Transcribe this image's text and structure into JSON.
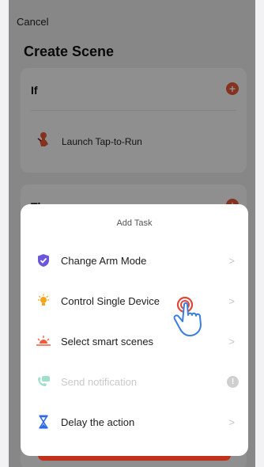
{
  "header": {
    "cancel_label": "Cancel",
    "title": "Create Scene"
  },
  "if_section": {
    "label": "If",
    "trigger_label": "Launch Tap-to-Run",
    "trigger_icon": "tap-hand-icon"
  },
  "then_section": {
    "label": "Then"
  },
  "sheet": {
    "title": "Add Task",
    "items": [
      {
        "label": "Change Arm Mode",
        "icon": "shield-check-icon",
        "disabled": false
      },
      {
        "label": "Control Single Device",
        "icon": "bulb-icon",
        "disabled": false
      },
      {
        "label": "Select smart scenes",
        "icon": "sunrise-icon",
        "disabled": false
      },
      {
        "label": "Send notification",
        "icon": "notification-phone-icon",
        "disabled": true
      },
      {
        "label": "Delay the action",
        "icon": "hourglass-icon",
        "disabled": false
      }
    ],
    "info_symbol": "!"
  },
  "colors": {
    "accent_red": "#ef5a3a",
    "shield_purple": "#6b57d8",
    "bulb_orange": "#f4a51c",
    "hourglass_blue": "#2c67e6"
  }
}
